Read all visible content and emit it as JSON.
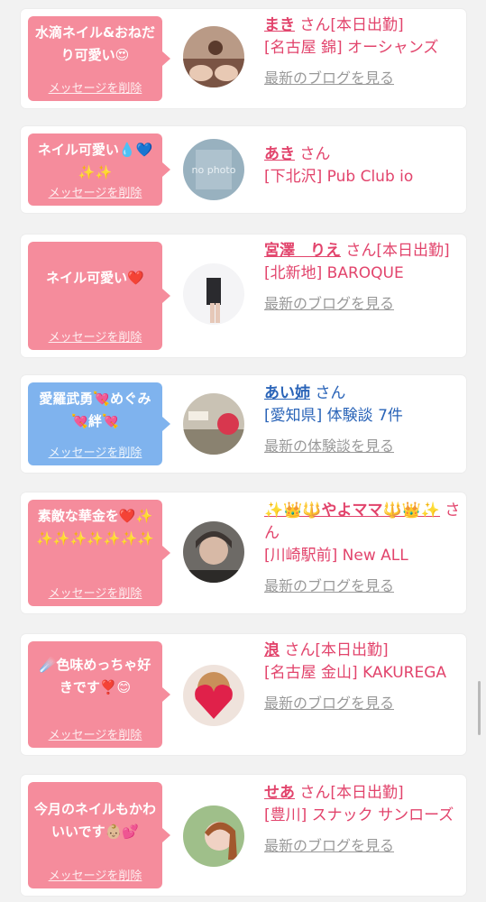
{
  "cards": [
    {
      "message": "水滴ネイル&おねだり可愛い😍",
      "delete_label": "メッセージを削除",
      "avatar_icon": "avatar-photo-icon",
      "name": "まき",
      "suffix": " さん[本日出勤]",
      "location": "[名古屋 錦] オーシャンズ",
      "link": "最新のブログを見る"
    },
    {
      "message": "ネイル可愛い💧💙✨✨",
      "delete_label": "メッセージを削除",
      "avatar_icon": "no-photo-icon",
      "avatar_text": "no photo",
      "name": "あき",
      "suffix": " さん",
      "location": "[下北沢] Pub Club io",
      "link": ""
    },
    {
      "message": "ネイル可愛い❤️",
      "delete_label": "メッセージを削除",
      "avatar_icon": "avatar-photo-icon",
      "name": "宮澤　りえ",
      "suffix": " さん[本日出勤]",
      "location": "[北新地] BAROQUE",
      "link": "最新のブログを見る"
    },
    {
      "message": "愛羅武勇💘めぐみ💘絆💘",
      "delete_label": "メッセージを削除",
      "avatar_icon": "avatar-photo-icon",
      "name": "あい姉",
      "suffix": " さん",
      "location": "[愛知県] 体験談 7件",
      "link": "最新の体験談を見る"
    },
    {
      "message": "素敵な華金を❤️✨✨✨✨✨✨✨✨",
      "delete_label": "メッセージを削除",
      "avatar_icon": "avatar-photo-icon",
      "name": "✨👑🔱やよママ🔱👑✨",
      "suffix": " さん",
      "location": "[川崎駅前] New ALL",
      "link": "最新のブログを見る"
    },
    {
      "message": "☄️色味めっちゃ好きです❣️😊",
      "delete_label": "メッセージを削除",
      "avatar_icon": "avatar-photo-icon",
      "name": "浪",
      "suffix": " さん[本日出勤]",
      "location": "[名古屋 金山] KAKUREGA",
      "link": "最新のブログを見る"
    },
    {
      "message": "今月のネイルもかわいいです👶🏼💕",
      "delete_label": "メッセージを削除",
      "avatar_icon": "avatar-photo-icon",
      "name": "せあ",
      "suffix": " さん[本日出勤]",
      "location": "[豊川] スナック サンローズ",
      "link": "最新のブログを見る"
    }
  ],
  "colors": {
    "accent_pink": "#e2446c",
    "bubble_pink": "#f58c9c",
    "bubble_blue": "#7fb3ee",
    "link_blue": "#2a64b8",
    "link_gray": "#999999"
  }
}
